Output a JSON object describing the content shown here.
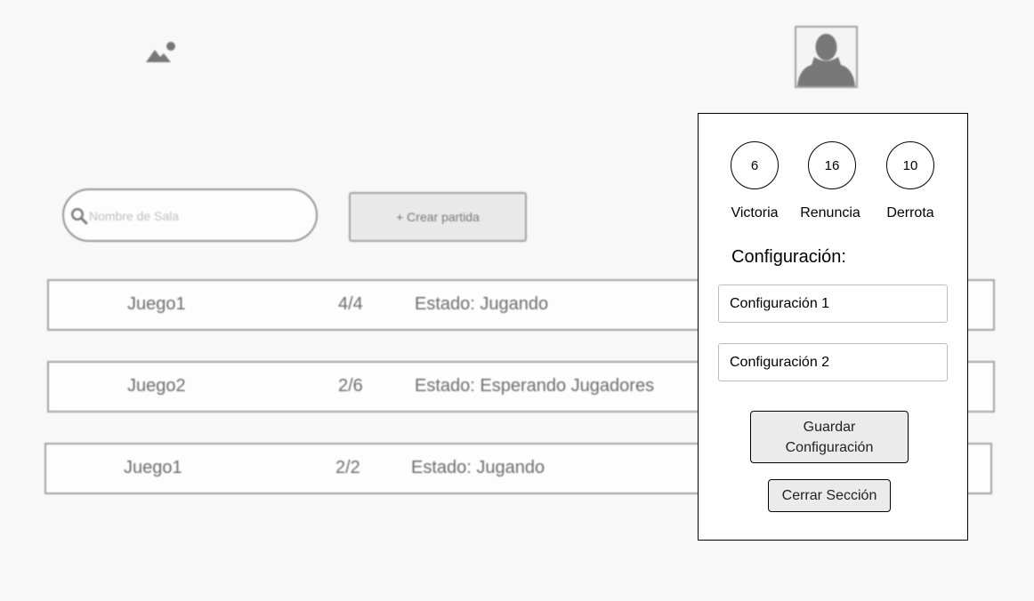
{
  "header": {
    "logo_icon": "image-icon",
    "avatar_icon": "user-avatar-icon"
  },
  "search": {
    "placeholder": "Nombre de Sala",
    "icon": "search-icon"
  },
  "create_button": {
    "label": "+ Crear partida"
  },
  "games": [
    {
      "name": "Juego1",
      "players": "4/4",
      "status": "Estado: Jugando"
    },
    {
      "name": "Juego2",
      "players": "2/6",
      "status": "Estado: Esperando Jugadores"
    },
    {
      "name": "Juego1",
      "players": "2/2",
      "status": "Estado: Jugando"
    }
  ],
  "profile_panel": {
    "stats": [
      {
        "value": "6",
        "label": "Victoria"
      },
      {
        "value": "16",
        "label": "Renuncia"
      },
      {
        "value": "10",
        "label": "Derrota"
      }
    ],
    "config_title": "Configuración:",
    "config_fields": [
      {
        "value": "Configuración 1"
      },
      {
        "value": "Configuración 2"
      }
    ],
    "save_button": {
      "line1": "Guardar",
      "line2": "Configuración"
    },
    "logout_button": "Cerrar Sección"
  }
}
